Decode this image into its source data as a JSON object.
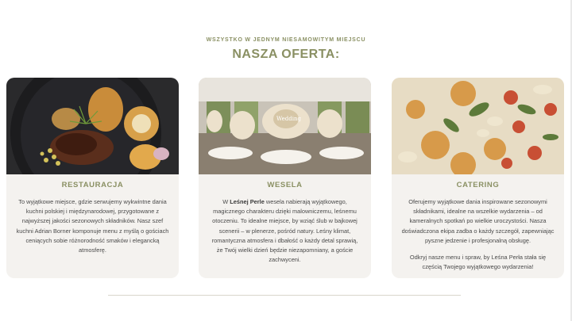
{
  "section": {
    "eyebrow": "WSZYSTKO W JEDNYM NIESAMOWITYM MIEJSCU",
    "title": "NASZA OFERTA:"
  },
  "cards": [
    {
      "title": "RESTAURACJA",
      "image": "restaurant-dish-image",
      "text": "To wyjątkowe miejsce, gdzie serwujemy wykwintne dania kuchni polskiej i międzynarodowej, przygotowane z najwyższej jakości sezonowych składników. Nasz szef kuchni Adrian Borner komponuje menu z myślą o gościach ceniących sobie różnorodność smaków i elegancką atmosferę."
    },
    {
      "title": "WESELA",
      "image": "wedding-hall-image",
      "text_pre": "W ",
      "text_bold": "Leśnej Perle",
      "text_post": " wesela nabierają wyjątkowego, magicznego charakteru dzięki malowniczemu, leśnemu otoczeniu. To idealne miejsce, by wziąć ślub w bajkowej scenerii – w plenerze, pośród natury. Leśny klimat, romantyczna atmosfera i dbałość o każdy detal sprawią, że Twój wielki dzień będzie niezapomniany, a goście zachwyceni."
    },
    {
      "title": "CATERING",
      "image": "catering-food-image",
      "text": "Oferujemy wyjątkowe dania inspirowane sezonowymi składnikami, idealne na wszelkie wydarzenia – od kameralnych spotkań po wielkie uroczystości. Nasza doświadczona ekipa zadba o każdy szczegół, zapewniając pyszne jedzenie i profesjonalną obsługę.",
      "text2": "Odkryj nasze menu i spraw, by Leśna Perła stała się częścią Twojego wyjątkowego wydarzenia!"
    }
  ]
}
